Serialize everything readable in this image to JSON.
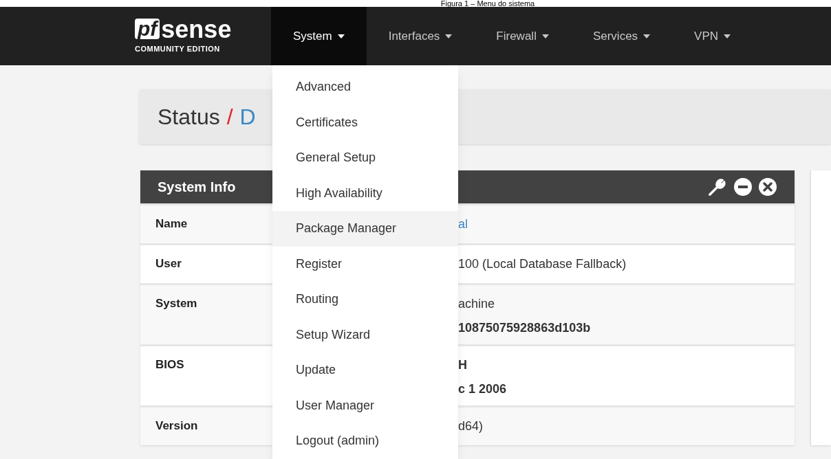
{
  "caption": "Figura 1 – Menu do sistema",
  "navbar": {
    "logo": {
      "mark": "pf",
      "word": "sense",
      "edition": "COMMUNITY EDITION"
    },
    "menus": [
      {
        "label": "System",
        "selected": true
      },
      {
        "label": "Interfaces",
        "selected": false
      },
      {
        "label": "Firewall",
        "selected": false
      },
      {
        "label": "Services",
        "selected": false
      },
      {
        "label": "VPN",
        "selected": false
      }
    ]
  },
  "breadcrumb": {
    "root": "Status",
    "separator": "/",
    "page": "D"
  },
  "dropdown": {
    "items": [
      {
        "label": "Advanced",
        "selected": false
      },
      {
        "label": "Certificates",
        "selected": false
      },
      {
        "label": "General Setup",
        "selected": false
      },
      {
        "label": "High Availability",
        "selected": false
      },
      {
        "label": "Package Manager",
        "selected": true
      },
      {
        "label": "Register",
        "selected": false
      },
      {
        "label": "Routing",
        "selected": false
      },
      {
        "label": "Setup Wizard",
        "selected": false
      },
      {
        "label": "Update",
        "selected": false
      },
      {
        "label": "User Manager",
        "selected": false
      },
      {
        "label": "Logout (admin)",
        "selected": false
      }
    ]
  },
  "panel": {
    "title": "System Info",
    "rows": [
      {
        "label": "Name",
        "lines": [
          {
            "text": "al",
            "kind": "link"
          }
        ]
      },
      {
        "label": "User",
        "lines": [
          {
            "text": "100 (Local Database Fallback)",
            "kind": "plain"
          }
        ]
      },
      {
        "label": "System",
        "lines": [
          {
            "text": "achine",
            "kind": "plain"
          },
          {
            "text": "10875075928863d103b",
            "kind": "bold"
          }
        ]
      },
      {
        "label": "BIOS",
        "lines": [
          {
            "text": "H",
            "kind": "bold"
          },
          {
            "text": "c 1 2006",
            "kind": "bold"
          }
        ]
      },
      {
        "label": "Version",
        "lines": [
          {
            "text": "d64)",
            "kind": "plain"
          }
        ]
      }
    ]
  }
}
